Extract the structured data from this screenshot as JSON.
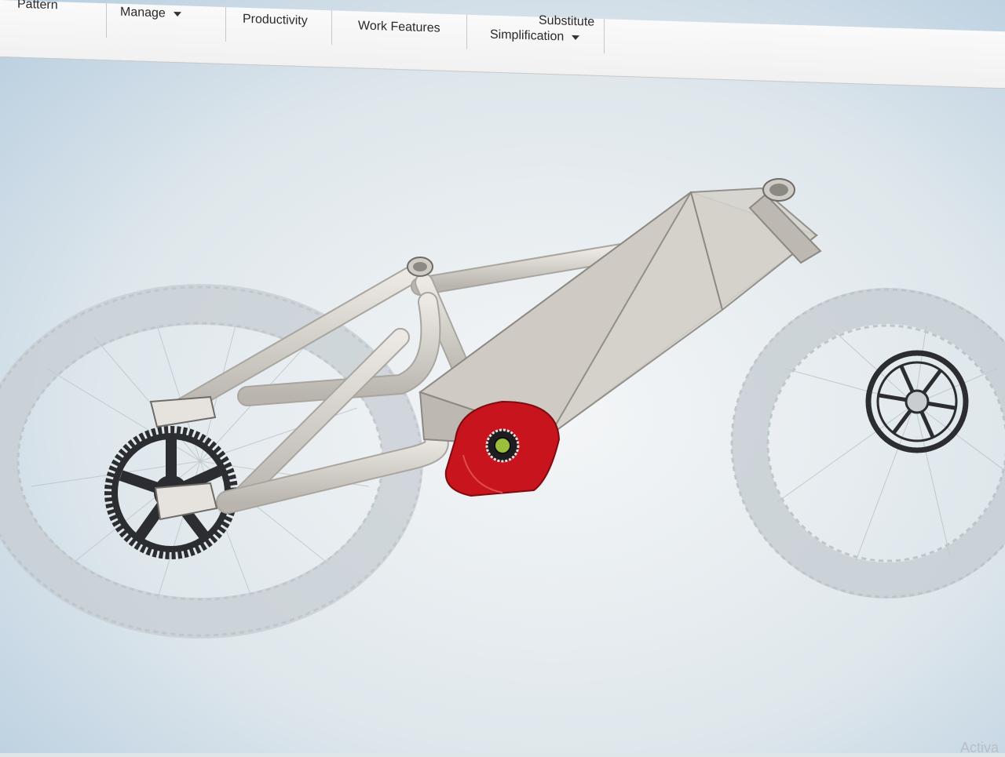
{
  "ribbon": {
    "items": [
      {
        "label": "Pattern",
        "dropdown": false
      },
      {
        "label": "Manage",
        "dropdown": true
      },
      {
        "label": "Productivity",
        "dropdown": false
      },
      {
        "label": "Work Features",
        "dropdown": false
      },
      {
        "label": "Substitute",
        "dropdown": false
      },
      {
        "label": "Simplification",
        "dropdown": true
      }
    ]
  },
  "model": {
    "frame_color": "#d9d6d0",
    "highlight_color": "#c8141c",
    "tire_color": "#cdd3d7",
    "chainring_color": "#2b2d30"
  },
  "watermark": "Activa"
}
